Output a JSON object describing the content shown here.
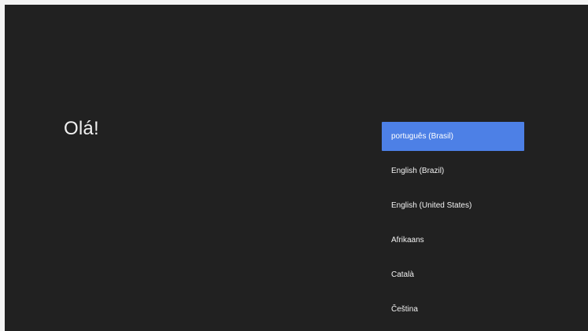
{
  "welcome": {
    "greeting": "Olá!"
  },
  "languages": {
    "items": [
      {
        "label": "português (Brasil)",
        "selected": true
      },
      {
        "label": "English (Brazil)",
        "selected": false
      },
      {
        "label": "English (United States)",
        "selected": false
      },
      {
        "label": "Afrikaans",
        "selected": false
      },
      {
        "label": "Català",
        "selected": false
      },
      {
        "label": "Čeština",
        "selected": false
      }
    ]
  },
  "colors": {
    "background": "#212121",
    "accent": "#4d80e6",
    "text": "#f2f2f2"
  }
}
